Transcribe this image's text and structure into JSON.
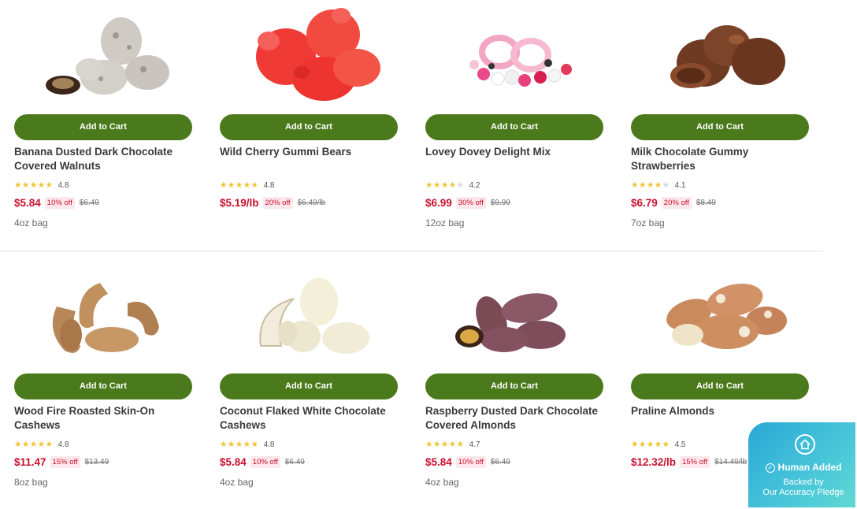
{
  "add_to_cart_label": "Add to Cart",
  "colors": {
    "button_green": "#4a7a1b",
    "price_red": "#c8102e",
    "star_yellow": "#f2c230",
    "pledge_blue": "#2aa8d6"
  },
  "products": [
    {
      "name": "Banana Dusted Dark Chocolate Covered Walnuts",
      "rating": "4.8",
      "stars": 4.8,
      "price": "$5.84",
      "discount": "10% off",
      "old_price": "$6.49",
      "size": "4oz bag",
      "image_icon": "walnuts-image"
    },
    {
      "name": "Wild Cherry Gummi Bears",
      "rating": "4.8",
      "stars": 4.8,
      "price": "$5.19/lb",
      "discount": "20% off",
      "old_price": "$6.49/lb",
      "size": "",
      "image_icon": "gummi-bears-image"
    },
    {
      "name": "Lovey Dovey Delight Mix",
      "rating": "4.2",
      "stars": 4.2,
      "price": "$6.99",
      "discount": "30% off",
      "old_price": "$9.99",
      "size": "12oz bag",
      "image_icon": "delight-mix-image"
    },
    {
      "name": "Milk Chocolate Gummy Strawberries",
      "rating": "4.1",
      "stars": 4.1,
      "price": "$6.79",
      "discount": "20% off",
      "old_price": "$8.49",
      "size": "7oz bag",
      "image_icon": "chocolate-strawberries-image"
    },
    {
      "name": "Wood Fire Roasted Skin-On Cashews",
      "rating": "4.8",
      "stars": 4.8,
      "price": "$11.47",
      "discount": "15% off",
      "old_price": "$13.49",
      "size": "8oz bag",
      "image_icon": "cashews-image"
    },
    {
      "name": "Coconut Flaked White Chocolate Cashews",
      "rating": "4.8",
      "stars": 4.8,
      "price": "$5.84",
      "discount": "10% off",
      "old_price": "$6.49",
      "size": "4oz bag",
      "image_icon": "white-chocolate-cashews-image"
    },
    {
      "name": "Raspberry Dusted Dark Chocolate Covered Almonds",
      "rating": "4.7",
      "stars": 4.7,
      "price": "$5.84",
      "discount": "10% off",
      "old_price": "$6.49",
      "size": "4oz bag",
      "image_icon": "chocolate-almonds-image"
    },
    {
      "name": "Praline Almonds",
      "rating": "4.5",
      "stars": 4.5,
      "price": "$12.32/lb",
      "discount": "15% off",
      "old_price": "$14.49/lb",
      "size": "",
      "image_icon": "praline-almonds-image"
    }
  ],
  "pledge": {
    "headline": "Human Added",
    "line1": "Backed by",
    "line2": "Our Accuracy Pledge",
    "logo_icon": "house-logo-icon",
    "check_icon": "check-circle-icon"
  }
}
